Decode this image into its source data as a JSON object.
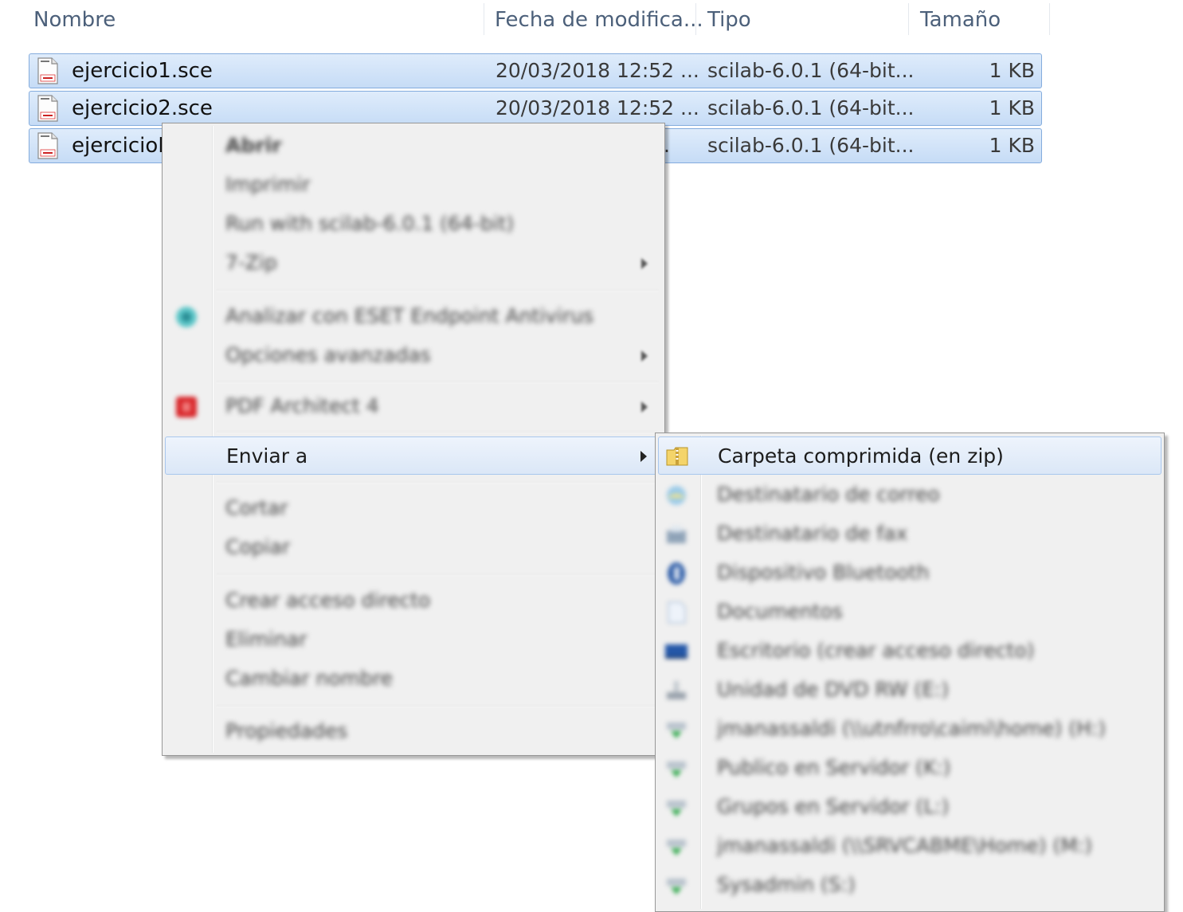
{
  "columns": {
    "name": "Nombre",
    "date": "Fecha de modifica...",
    "type": "Tipo",
    "size": "Tamaño"
  },
  "files": [
    {
      "name": "ejercicio1.sce",
      "date": "20/03/2018 12:52 ...",
      "type": "scilab-6.0.1 (64-bit...",
      "size": "1 KB",
      "selected": true
    },
    {
      "name": "ejercicio2.sce",
      "date": "20/03/2018 12:52 ...",
      "type": "scilab-6.0.1 (64-bit...",
      "size": "1 KB",
      "selected": true
    },
    {
      "name": "ejercicioN",
      "date": ".",
      "type": "scilab-6.0.1 (64-bit...",
      "size": "1 KB",
      "selected": true
    }
  ],
  "context_menu": {
    "items": [
      {
        "label": "Abrir",
        "bold": true,
        "blurred": true
      },
      {
        "label": "Imprimir",
        "blurred": true
      },
      {
        "label": "Run with scilab-6.0.1 (64-bit)",
        "blurred": true
      },
      {
        "label": "7-Zip",
        "submenu": true,
        "blurred": true
      },
      {
        "label": "Analizar con ESET Endpoint Antivirus",
        "icon": "eset-shield-icon",
        "blurred": true
      },
      {
        "label": "Opciones avanzadas",
        "submenu": true,
        "blurred": true
      },
      {
        "label": "PDF Architect 4",
        "icon": "pdf-architect-icon",
        "submenu": true,
        "blurred": true
      },
      {
        "label": "Enviar a",
        "submenu": true,
        "highlighted": true
      },
      {
        "label": "Cortar",
        "blurred": true
      },
      {
        "label": "Copiar",
        "blurred": true
      },
      {
        "label": "Crear acceso directo",
        "blurred": true
      },
      {
        "label": "Eliminar",
        "blurred": true
      },
      {
        "label": "Cambiar nombre",
        "blurred": true
      },
      {
        "label": "Propiedades",
        "blurred": true
      }
    ]
  },
  "send_to_menu": {
    "items": [
      {
        "label": "Carpeta comprimida (en zip)",
        "icon": "zip-folder-icon",
        "highlighted": true
      },
      {
        "label": "Destinatario de correo",
        "icon": "mail-recipient-icon",
        "blurred": true
      },
      {
        "label": "Destinatario de fax",
        "icon": "fax-icon",
        "blurred": true
      },
      {
        "label": "Dispositivo Bluetooth",
        "icon": "bluetooth-icon",
        "blurred": true
      },
      {
        "label": "Documentos",
        "icon": "documents-icon",
        "blurred": true
      },
      {
        "label": "Escritorio (crear acceso directo)",
        "icon": "desktop-icon",
        "blurred": true
      },
      {
        "label": "Unidad de DVD RW (E:)",
        "icon": "dvd-drive-icon",
        "blurred": true
      },
      {
        "label": "jmanassaldi (\\\\utnfrro\\caimi\\home) (H:)",
        "icon": "network-drive-icon",
        "blurred": true
      },
      {
        "label": "Publico en Servidor (K:)",
        "icon": "network-drive-icon",
        "blurred": true
      },
      {
        "label": "Grupos en Servidor (L:)",
        "icon": "network-drive-icon",
        "blurred": true
      },
      {
        "label": "jmanassaldi (\\\\SRVCABME\\Home) (M:)",
        "icon": "network-drive-icon",
        "blurred": true
      },
      {
        "label": "Sysadmin (S:)",
        "icon": "network-drive-icon",
        "blurred": true
      }
    ]
  },
  "colors": {
    "selection_fill": "#c6dcf6",
    "selection_border": "#84acdd",
    "menu_background": "#f0f0f0",
    "header_text": "#4c607a"
  }
}
